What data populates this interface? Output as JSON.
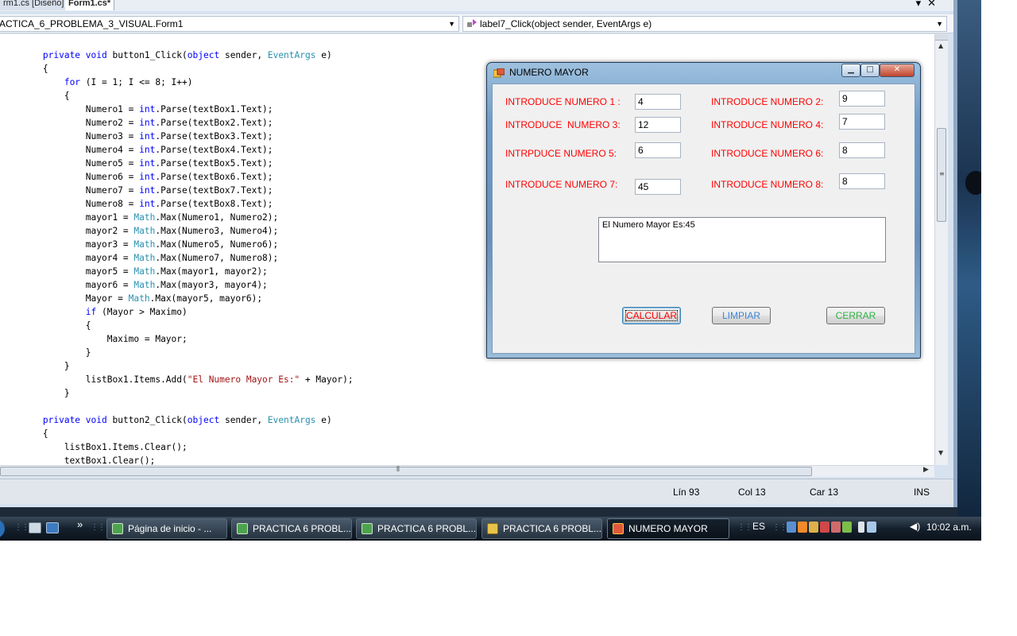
{
  "ide": {
    "doc_tabs": {
      "design_tab": "rm1.cs [Diseño]",
      "code_tab": "Form1.cs*"
    },
    "nav": {
      "class_combo": "ACTICA_6_PROBLEMA_3_VISUAL.Form1",
      "member_combo": "label7_Click(object sender, EventArgs e)"
    },
    "status": {
      "line": "Lín 93",
      "col": "Col 13",
      "car": "Car 13",
      "ins": "INS"
    }
  },
  "code_lines": [
    [
      [
        "",
        "        "
      ],
      [
        "kw",
        "private"
      ],
      [
        "",
        " "
      ],
      [
        "kw",
        "void"
      ],
      [
        "",
        " button1_Click("
      ],
      [
        "kw",
        "object"
      ],
      [
        "",
        " sender, "
      ],
      [
        "ty",
        "EventArgs"
      ],
      [
        "",
        " e)"
      ]
    ],
    [
      [
        "",
        "        {"
      ]
    ],
    [
      [
        "",
        "            "
      ],
      [
        "kw",
        "for"
      ],
      [
        "",
        " (I = 1; I <= 8; I++)"
      ]
    ],
    [
      [
        "",
        "            {"
      ]
    ],
    [
      [
        "",
        "                Numero1 = "
      ],
      [
        "kw",
        "int"
      ],
      [
        "",
        ".Parse(textBox1.Text);"
      ]
    ],
    [
      [
        "",
        "                Numero2 = "
      ],
      [
        "kw",
        "int"
      ],
      [
        "",
        ".Parse(textBox2.Text);"
      ]
    ],
    [
      [
        "",
        "                Numero3 = "
      ],
      [
        "kw",
        "int"
      ],
      [
        "",
        ".Parse(textBox3.Text);"
      ]
    ],
    [
      [
        "",
        "                Numero4 = "
      ],
      [
        "kw",
        "int"
      ],
      [
        "",
        ".Parse(textBox4.Text);"
      ]
    ],
    [
      [
        "",
        "                Numero5 = "
      ],
      [
        "kw",
        "int"
      ],
      [
        "",
        ".Parse(textBox5.Text);"
      ]
    ],
    [
      [
        "",
        "                Numero6 = "
      ],
      [
        "kw",
        "int"
      ],
      [
        "",
        ".Parse(textBox6.Text);"
      ]
    ],
    [
      [
        "",
        "                Numero7 = "
      ],
      [
        "kw",
        "int"
      ],
      [
        "",
        ".Parse(textBox7.Text);"
      ]
    ],
    [
      [
        "",
        "                Numero8 = "
      ],
      [
        "kw",
        "int"
      ],
      [
        "",
        ".Parse(textBox8.Text);"
      ]
    ],
    [
      [
        "",
        "                mayor1 = "
      ],
      [
        "ty",
        "Math"
      ],
      [
        "",
        ".Max(Numero1, Numero2);"
      ]
    ],
    [
      [
        "",
        "                mayor2 = "
      ],
      [
        "ty",
        "Math"
      ],
      [
        "",
        ".Max(Numero3, Numero4);"
      ]
    ],
    [
      [
        "",
        "                mayor3 = "
      ],
      [
        "ty",
        "Math"
      ],
      [
        "",
        ".Max(Numero5, Numero6);"
      ]
    ],
    [
      [
        "",
        "                mayor4 = "
      ],
      [
        "ty",
        "Math"
      ],
      [
        "",
        ".Max(Numero7, Numero8);"
      ]
    ],
    [
      [
        "",
        "                mayor5 = "
      ],
      [
        "ty",
        "Math"
      ],
      [
        "",
        ".Max(mayor1, mayor2);"
      ]
    ],
    [
      [
        "",
        "                mayor6 = "
      ],
      [
        "ty",
        "Math"
      ],
      [
        "",
        ".Max(mayor3, mayor4);"
      ]
    ],
    [
      [
        "",
        "                Mayor = "
      ],
      [
        "ty",
        "Math"
      ],
      [
        "",
        ".Max(mayor5, mayor6);"
      ]
    ],
    [
      [
        "",
        "                "
      ],
      [
        "kw",
        "if"
      ],
      [
        "",
        " (Mayor > Maximo)"
      ]
    ],
    [
      [
        "",
        "                {"
      ]
    ],
    [
      [
        "",
        "                    Maximo = Mayor;"
      ]
    ],
    [
      [
        "",
        "                }"
      ]
    ],
    [
      [
        "",
        "            }"
      ]
    ],
    [
      [
        "",
        "                listBox1.Items.Add("
      ],
      [
        "st",
        "\"El Numero Mayor Es:\""
      ],
      [
        "",
        " + Mayor);"
      ]
    ],
    [
      [
        "",
        "            }"
      ]
    ],
    [
      [
        "",
        ""
      ]
    ],
    [
      [
        "",
        "        "
      ],
      [
        "kw",
        "private"
      ],
      [
        "",
        " "
      ],
      [
        "kw",
        "void"
      ],
      [
        "",
        " button2_Click("
      ],
      [
        "kw",
        "object"
      ],
      [
        "",
        " sender, "
      ],
      [
        "ty",
        "EventArgs"
      ],
      [
        "",
        " e)"
      ]
    ],
    [
      [
        "",
        "        {"
      ]
    ],
    [
      [
        "",
        "            listBox1.Items.Clear();"
      ]
    ],
    [
      [
        "",
        "            textBox1.Clear();"
      ]
    ]
  ],
  "form": {
    "title": "NUMERO MAYOR",
    "labels": {
      "n1": "INTRODUCE NUMERO 1 :",
      "n2": "INTRODUCE NUMERO 2:",
      "n3": "INTRODUCE  NUMERO 3:",
      "n4": "INTRODUCE NUMERO 4:",
      "n5": "INTRPDUCE NUMERO 5:",
      "n6": "INTRODUCE NUMERO 6:",
      "n7": "INTRODUCE NUMERO 7:",
      "n8": "INTRODUCE NUMERO 8:"
    },
    "values": {
      "n1": "4",
      "n2": "9",
      "n3": "12",
      "n4": "7",
      "n5": "6",
      "n6": "8",
      "n7": "45",
      "n8": "8"
    },
    "listbox_item": "El Numero Mayor Es:45",
    "buttons": {
      "calcular": "CALCULAR",
      "limpiar": "LIMPIAR",
      "cerrar": "CERRAR"
    },
    "colors": {
      "label": "#ff0000",
      "calcular": "#ff0000",
      "limpiar": "#3d86d8",
      "cerrar": "#2fb344"
    }
  },
  "taskbar": {
    "chevron": "»",
    "buttons": [
      {
        "label": "Página de inicio - ...",
        "icon": "visual-studio-icon"
      },
      {
        "label": "PRACTICA 6 PROBL...",
        "icon": "visual-studio-icon"
      },
      {
        "label": "PRACTICA 6 PROBL...",
        "icon": "visual-studio-icon"
      },
      {
        "label": "PRACTICA 6 PROBL...",
        "icon": "folder-icon"
      },
      {
        "label": "NUMERO MAYOR",
        "icon": "form-app-icon"
      }
    ],
    "language": "ES",
    "clock": "10:02 a.m."
  }
}
